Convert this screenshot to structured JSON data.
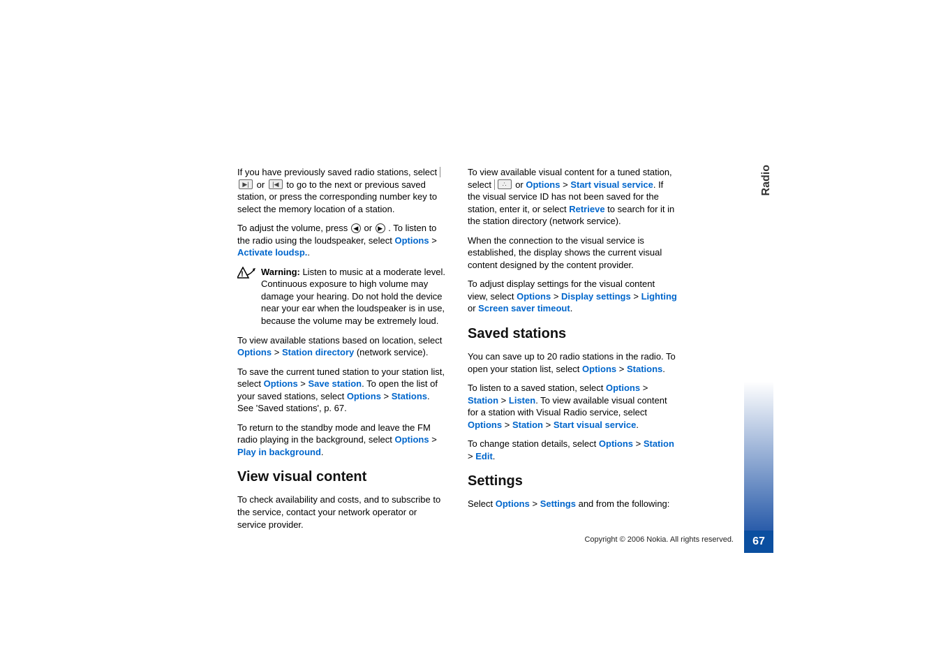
{
  "side_tab": "Radio",
  "page_number": "67",
  "copyright": "Copyright © 2006 Nokia. All rights reserved.",
  "col1": {
    "p1_a": "If you have previously saved radio stations, select ",
    "p1_b": " or ",
    "p1_c": " to go to the next or previous saved station, or press the corresponding number key to select the memory location of a station.",
    "p2_a": "To adjust the volume, press ",
    "p2_b": " or ",
    "p2_c": ". To listen to the radio using the loudspeaker, select ",
    "options": "Options",
    "gt": " > ",
    "activate_loudsp": "Activate loudsp.",
    "p2_end": ".",
    "warn_label": "Warning:",
    "warn_text": " Listen to music at a moderate level. Continuous exposure to high volume may damage your hearing. Do not hold the device near your ear when the loudspeaker is in use, because the volume may be extremely loud.",
    "p4_a": "To view available stations based on location, select ",
    "station_directory": "Station directory",
    "p4_b": " (network service).",
    "p5_a": "To save the current tuned station to your station list, select ",
    "save_station": "Save station",
    "p5_b": ". To open the list of your saved stations, select ",
    "stations": "Stations",
    "p5_c": ". See 'Saved stations', p. 67.",
    "p6_a": "To return to the standby mode and leave the FM radio playing in the background, select ",
    "play_in_bg": "Play in background",
    "h_view": "View visual content",
    "p7": "To check availability and costs, and to subscribe to the service, contact your network operator or service provider."
  },
  "col2": {
    "p1_a": "To view available visual content for a tuned station, select ",
    "p1_b": " or ",
    "options": "Options",
    "gt": " > ",
    "start_visual": "Start visual service",
    "p1_c": ". If the visual service ID has not been saved for the station, enter it, or select ",
    "retrieve": "Retrieve",
    "p1_d": " to search for it in the station directory (network service).",
    "p2": "When the connection to the visual service is established, the display shows the current visual content designed by the content provider.",
    "p3_a": "To adjust display settings for the visual content view, select ",
    "display_settings": "Display settings",
    "lighting": "Lighting",
    "or": " or ",
    "screen_saver": "Screen saver timeout",
    "h_saved": "Saved stations",
    "p4_a": "You can save up to 20 radio stations in the radio. To open your station list, select ",
    "stations": "Stations",
    "p5_a": "To listen to a saved station, select ",
    "station": "Station",
    "listen": "Listen",
    "p5_b": ". To view available visual content for a station with Visual Radio service, select ",
    "start_visual2": "Start visual service",
    "p6_a": "To change station details, select ",
    "edit": "Edit",
    "h_settings": "Settings",
    "p7_a": "Select ",
    "settings": "Settings",
    "p7_b": " and from the following:"
  }
}
